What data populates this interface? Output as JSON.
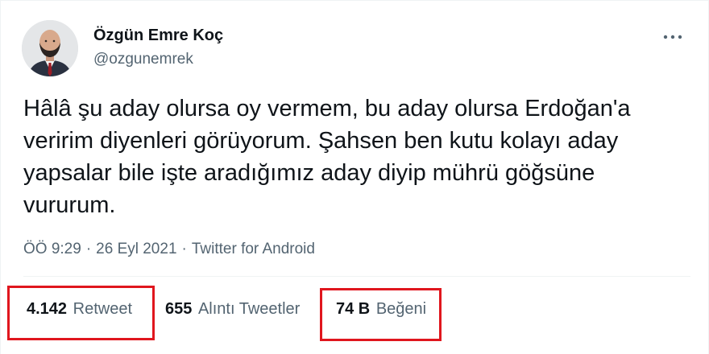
{
  "tweet": {
    "author": {
      "display_name": "Özgün Emre Koç",
      "handle": "@ozgunemrek"
    },
    "text": "Hâlâ şu aday olursa oy vermem, bu aday olursa Erdoğan'a veririm diyenleri görüyorum. Şahsen ben kutu kolayı aday yapsalar bile işte aradığımız aday diyip mührü göğsüne vururum.",
    "time": "ÖÖ 9:29",
    "date": "26 Eyl 2021",
    "meta_separator": "·",
    "source": "Twitter for Android",
    "stats": {
      "retweets": {
        "count": "4.142",
        "label": "Retweet"
      },
      "quotes": {
        "count": "655",
        "label": "Alıntı Tweetler"
      },
      "likes": {
        "count": "74 B",
        "label": "Beğeni"
      }
    }
  },
  "icons": {
    "more": "more-dots-icon",
    "avatar": "avatar"
  },
  "colors": {
    "text_primary": "#0f1419",
    "text_secondary": "#536471",
    "divider": "#eff3f4",
    "highlight_box": "#e0161e"
  }
}
